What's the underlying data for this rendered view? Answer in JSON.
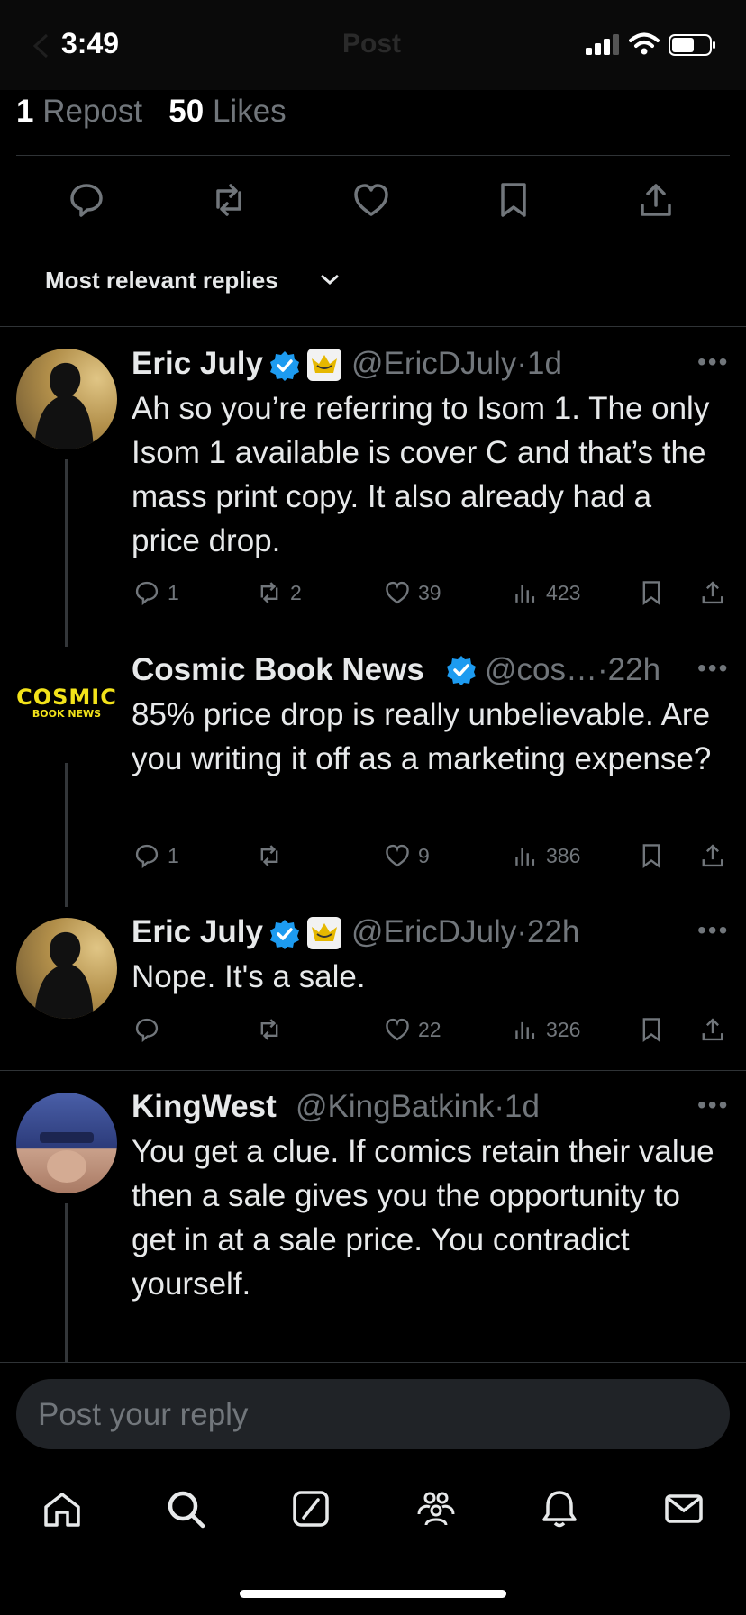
{
  "status_bar": {
    "time": "3:49",
    "header_title": "Post"
  },
  "stats": {
    "reposts_count": "1",
    "reposts_label": "Repost",
    "likes_count": "50",
    "likes_label": "Likes"
  },
  "sort": {
    "label": "Most relevant replies"
  },
  "replies": [
    {
      "name": "Eric July",
      "verified": true,
      "handle": "@EricDJuly",
      "time": "1d",
      "text": "Ah so you’re referring to Isom 1.  The only Isom 1 available is cover C and that’s the mass print copy. It also already had a price drop.",
      "replies": "1",
      "reposts": "2",
      "likes": "39",
      "views": "423"
    },
    {
      "name": "Cosmic Book News",
      "verified": true,
      "handle": "@cos…",
      "time": "22h",
      "avatar_text_1": "COSMIC",
      "avatar_text_2": "BOOK NEWS",
      "text": "85% price drop is really unbelievable. Are you writing it off as a marketing expense?",
      "replies": "1",
      "reposts": "",
      "likes": "9",
      "views": "386"
    },
    {
      "name": "Eric July",
      "verified": true,
      "handle": "@EricDJuly",
      "time": "22h",
      "text": "Nope. It's a sale.",
      "replies": "",
      "reposts": "",
      "likes": "22",
      "views": "326"
    },
    {
      "name": "KingWest",
      "verified": false,
      "handle": "@KingBatkink",
      "time": "1d",
      "text": "You get a clue. If comics retain their value then a sale gives you the opportunity to get in at a sale price. You contradict yourself."
    }
  ],
  "composer": {
    "placeholder": "Post your reply"
  },
  "colors": {
    "background": "#000000",
    "verified": "#1d9bf0",
    "muted": "#71767b",
    "text": "#e7e9ea"
  },
  "icons": {
    "actions": [
      "reply-icon",
      "repost-icon",
      "like-icon",
      "bookmark-icon",
      "share-icon"
    ],
    "nav": [
      "home-icon",
      "search-icon",
      "grok-icon",
      "communities-icon",
      "notifications-icon",
      "messages-icon"
    ]
  }
}
